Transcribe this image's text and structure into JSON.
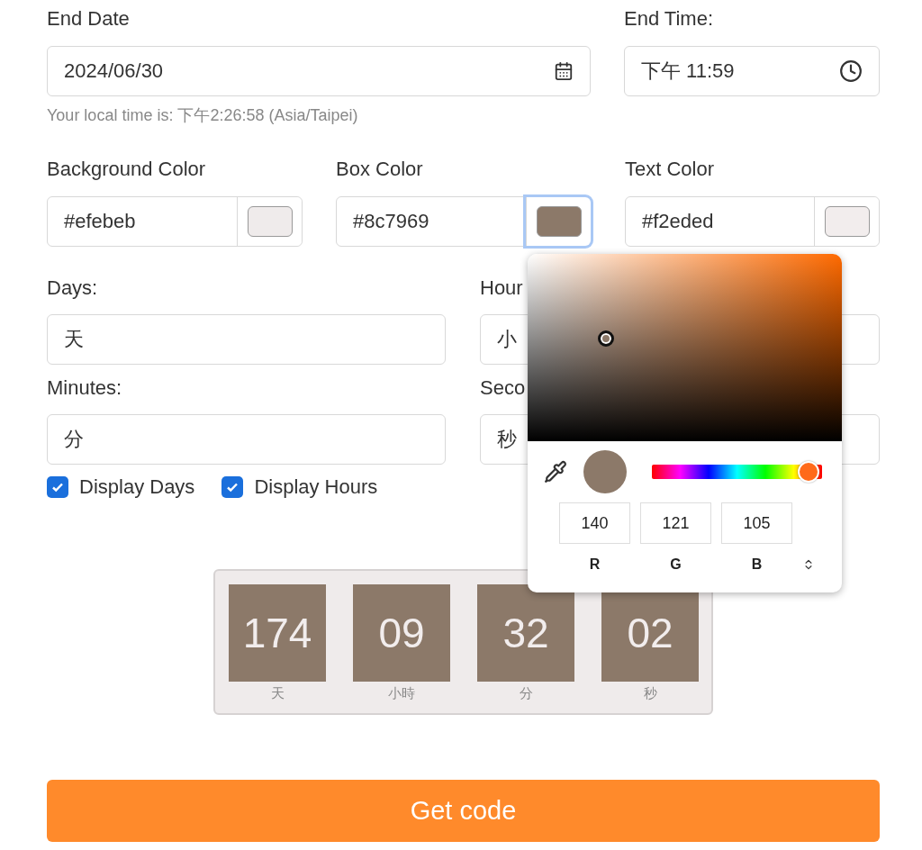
{
  "end_date": {
    "label": "End Date",
    "value": "2024/06/30"
  },
  "end_time": {
    "label": "End Time:",
    "value": "下午 11:59"
  },
  "local_time_hint": "Your local time is: 下午2:26:58 (Asia/Taipei)",
  "color_fields": [
    {
      "label": "Background Color",
      "value": "#efebeb",
      "color": "#efebeb",
      "selected": false
    },
    {
      "label": "Box Color",
      "value": "#8c7969",
      "color": "#8c7969",
      "selected": true
    },
    {
      "label": "Text Color",
      "value": "#f2eded",
      "color": "#f2eded",
      "selected": false
    }
  ],
  "unit_fields": [
    {
      "label": "Days:",
      "value": "天"
    },
    {
      "label": "Hour",
      "value": "小"
    },
    {
      "label": "Minutes:",
      "value": "分"
    },
    {
      "label": "Seco",
      "value": "秒"
    }
  ],
  "checkboxes": [
    {
      "label": "Display Days",
      "checked": true
    },
    {
      "label": "Display Hours",
      "checked": true
    }
  ],
  "color_picker": {
    "color": "#8c7969",
    "level": 0.92,
    "channels": [
      {
        "value": "140",
        "label": "R"
      },
      {
        "value": "121",
        "label": "G"
      },
      {
        "value": "105",
        "label": "B"
      }
    ]
  },
  "countdown": {
    "units": [
      {
        "value": "174",
        "label": "天"
      },
      {
        "value": "09",
        "label": "小時"
      },
      {
        "value": "32",
        "label": "分"
      },
      {
        "value": "02",
        "label": "秒"
      }
    ]
  },
  "get_code_button": "Get code"
}
